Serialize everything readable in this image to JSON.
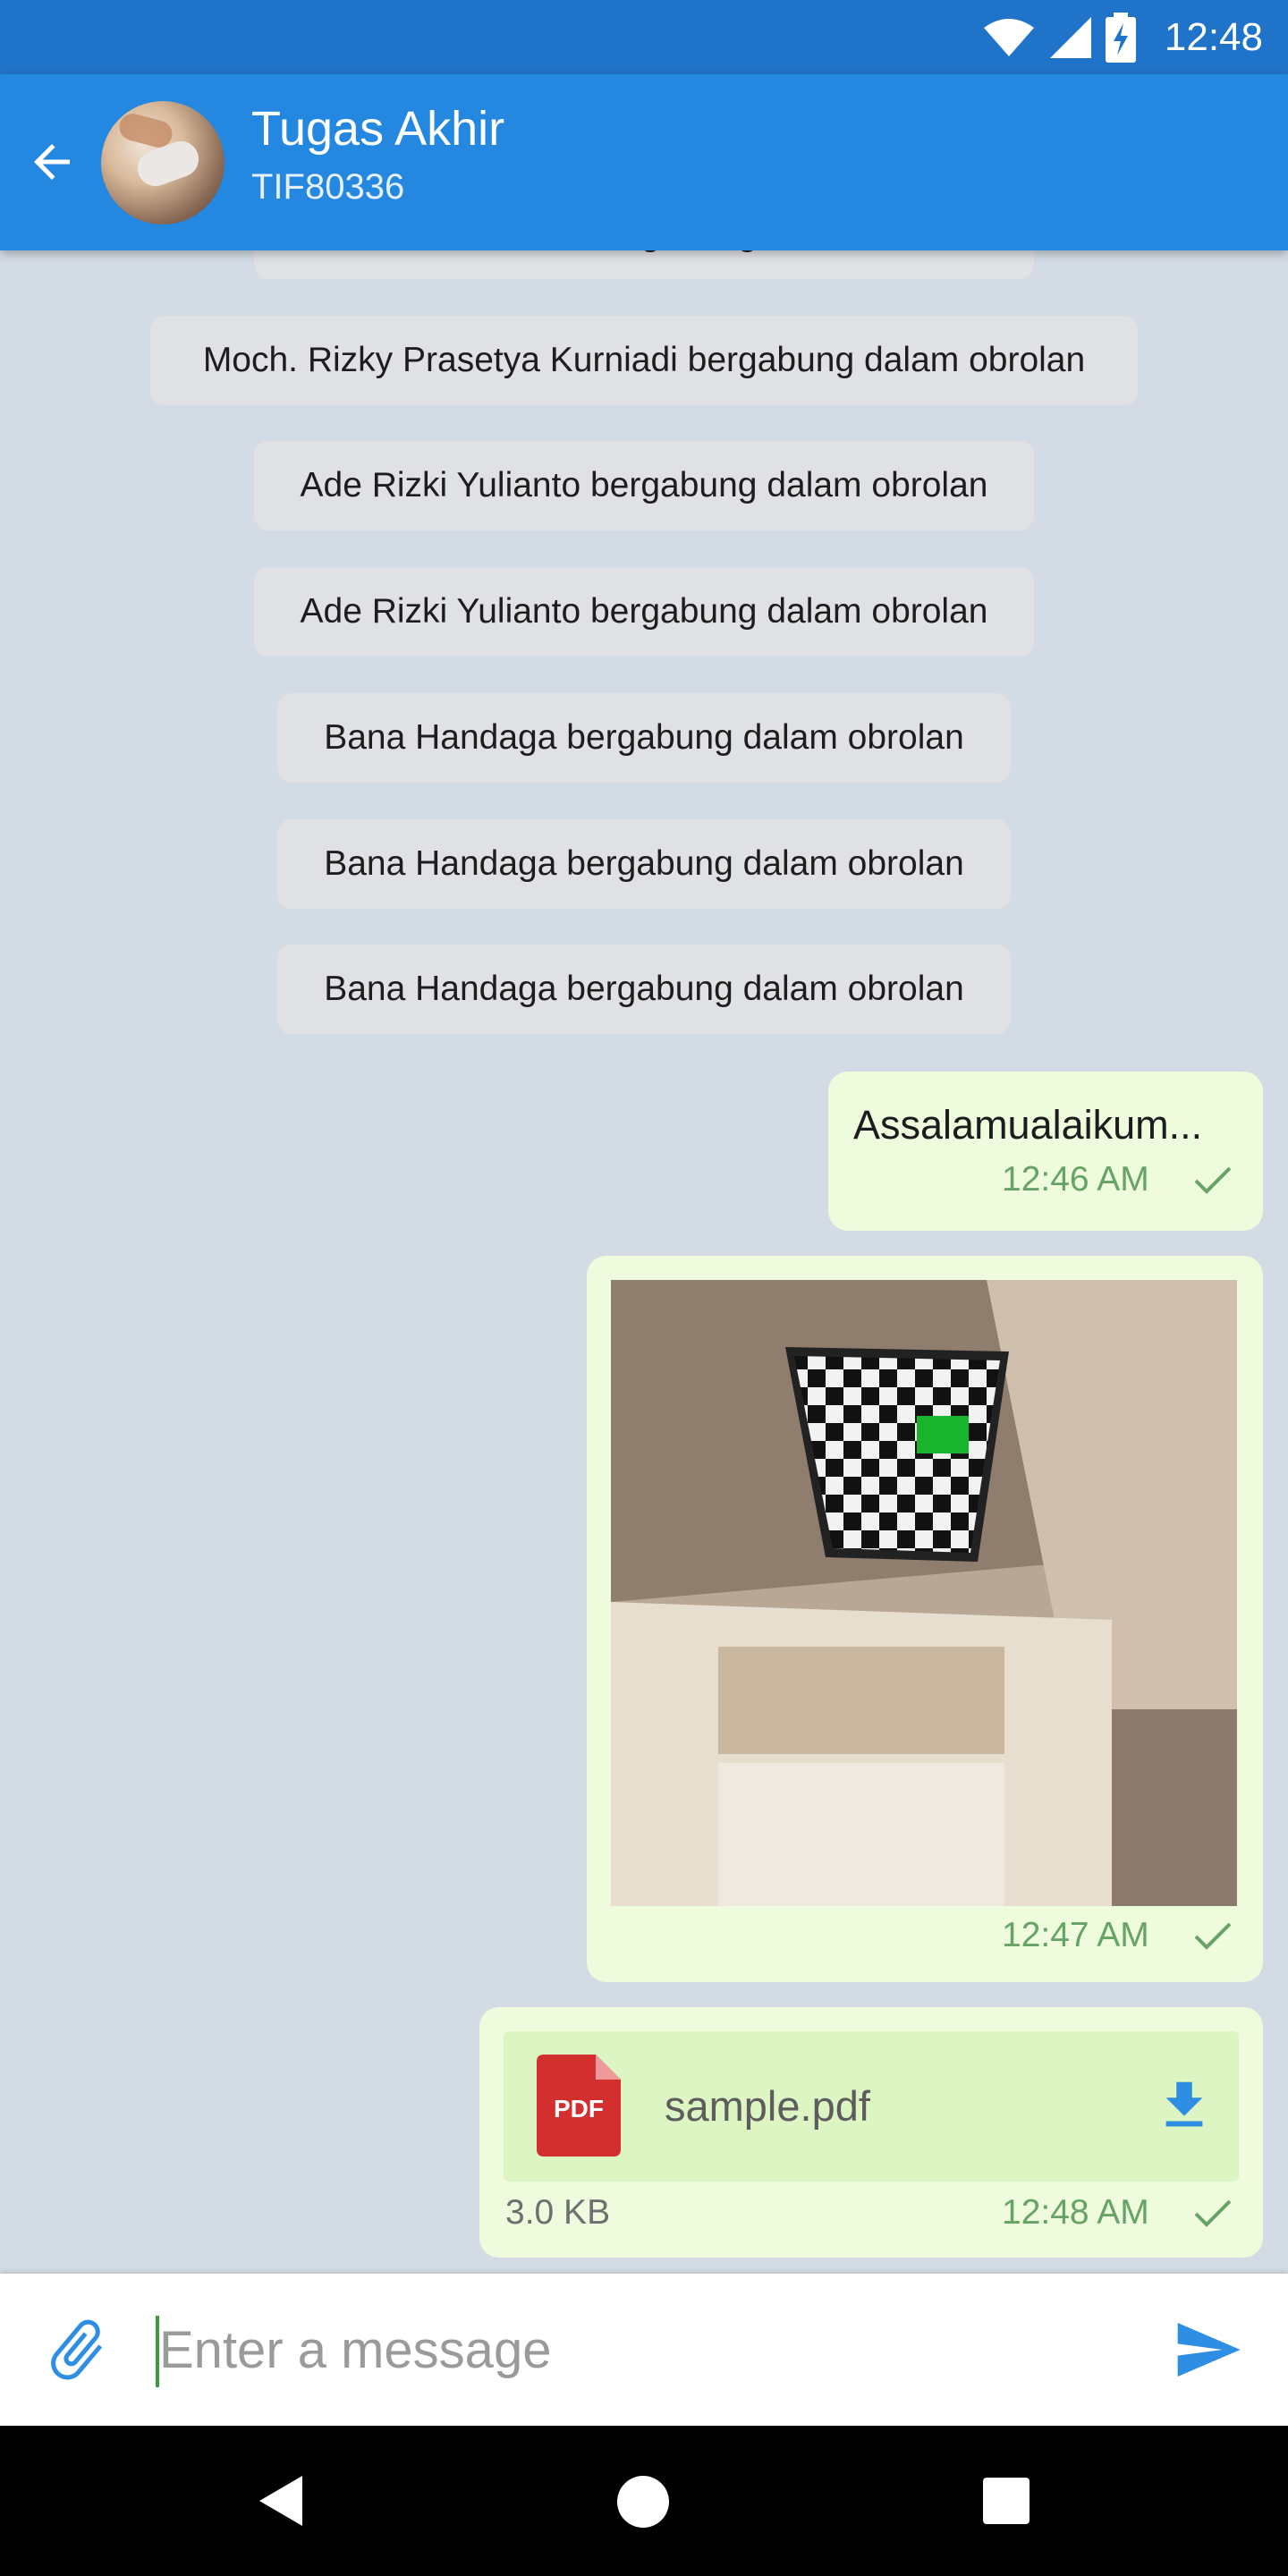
{
  "status_bar": {
    "time": "12:48",
    "icons": [
      "wifi-icon",
      "cell-signal-icon",
      "battery-charging-icon"
    ]
  },
  "header": {
    "title": "Tugas Akhir",
    "subtitle": "TIF80336",
    "back_icon": "arrow-back-icon"
  },
  "messages": {
    "system": [
      "Ade Rizki Yulianto bergabung dalam obrolan",
      "Moch. Rizky Prasetya Kurniadi bergabung dalam obrolan",
      "Ade Rizki Yulianto bergabung dalam obrolan",
      "Ade Rizki Yulianto bergabung dalam obrolan",
      "Bana Handaga bergabung dalam obrolan",
      "Bana Handaga bergabung dalam obrolan",
      "Bana Handaga bergabung dalam obrolan"
    ],
    "text_message": {
      "text": "Assalamualaikum...",
      "time": "12:46 AM",
      "status": "sent"
    },
    "image_message": {
      "time": "12:47 AM",
      "status": "sent"
    },
    "file_message": {
      "icon_label": "PDF",
      "file_name": "sample.pdf",
      "size": "3.0 KB",
      "time": "12:48 AM",
      "status": "sent"
    }
  },
  "composer": {
    "placeholder": "Enter a message",
    "value": ""
  },
  "colors": {
    "primary": "#2487e0",
    "status_bar": "#1f73c9",
    "outgoing_bubble": "#eefbdc",
    "check": "#67a367",
    "pdf_red": "#d32f2f"
  }
}
